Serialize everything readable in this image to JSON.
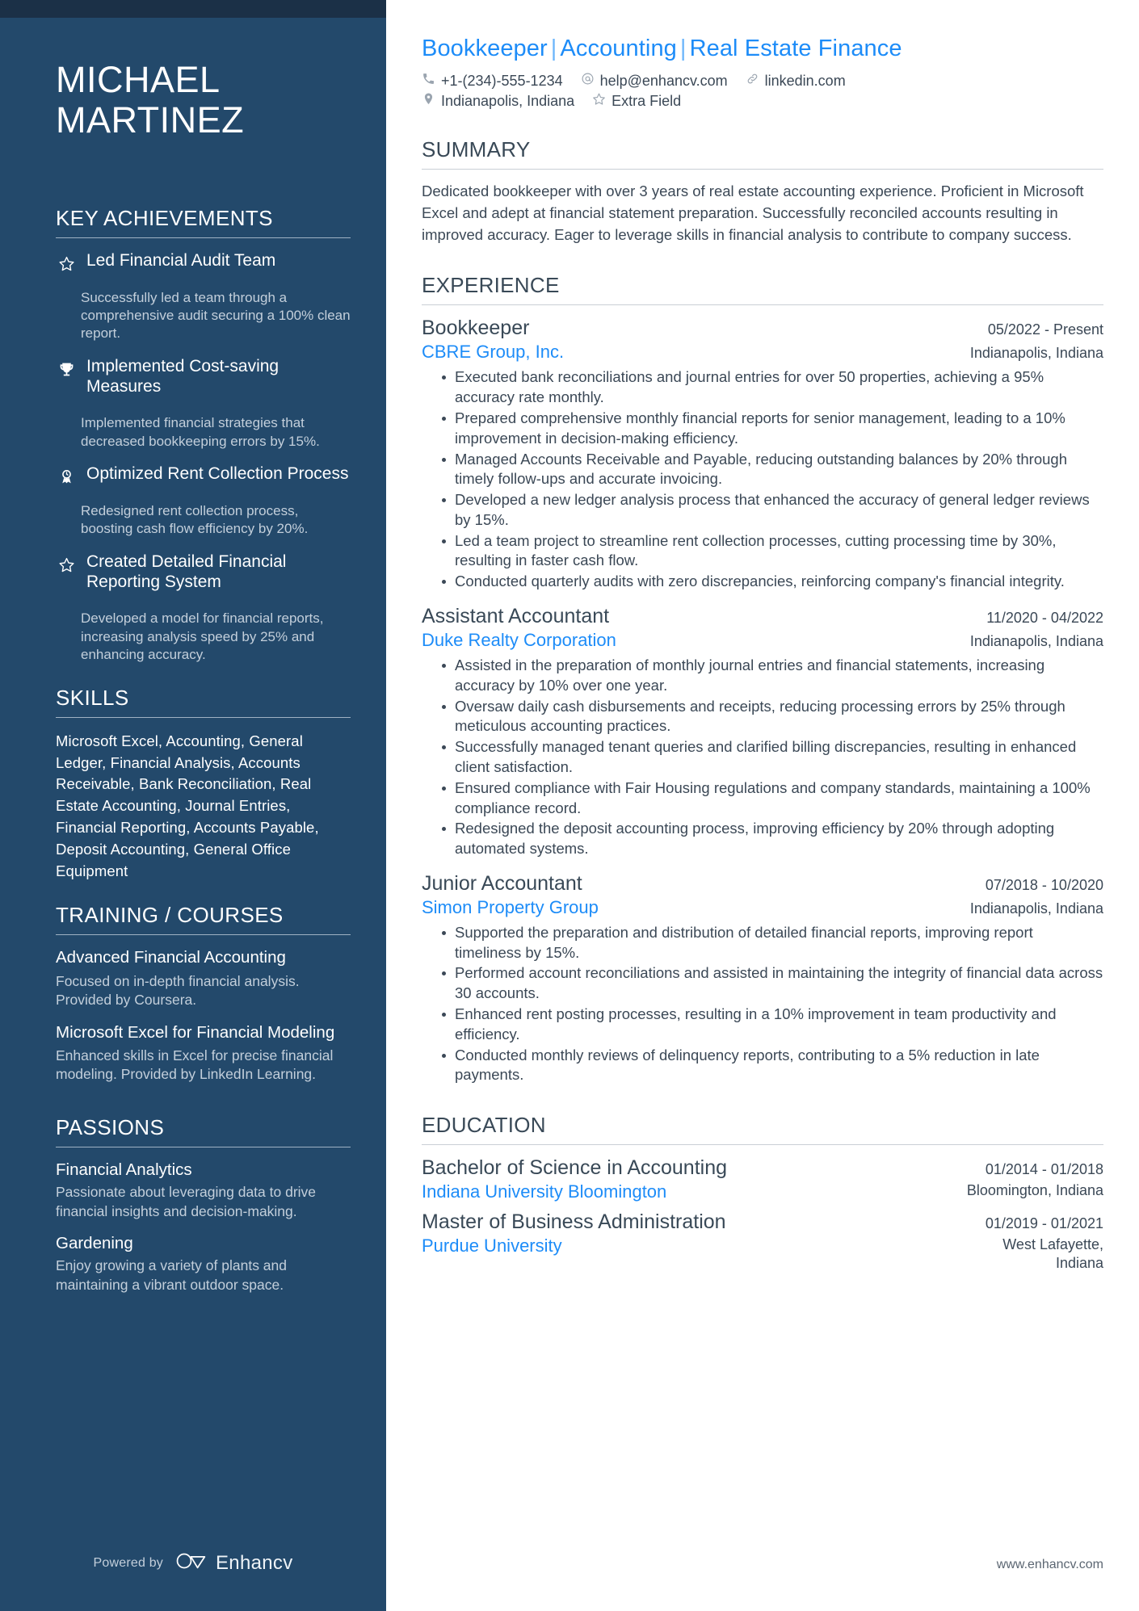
{
  "sidebar": {
    "name_line1": "MICHAEL",
    "name_line2": "MARTINEZ",
    "key_achievements": {
      "heading": "KEY ACHIEVEMENTS",
      "items": [
        {
          "icon": "star-icon",
          "title": "Led Financial Audit Team",
          "desc": "Successfully led a team through a comprehensive audit securing a 100% clean report."
        },
        {
          "icon": "trophy-icon",
          "title": "Implemented Cost-saving Measures",
          "desc": "Implemented financial strategies that decreased bookkeeping errors by 15%."
        },
        {
          "icon": "award-ribbon-icon",
          "title": "Optimized Rent Collection Process",
          "desc": "Redesigned rent collection process, boosting cash flow efficiency by 20%."
        },
        {
          "icon": "star-icon",
          "title": "Created Detailed Financial Reporting System",
          "desc": "Developed a model for financial reports, increasing analysis speed by 25% and enhancing accuracy."
        }
      ]
    },
    "skills": {
      "heading": "SKILLS",
      "text": "Microsoft Excel, Accounting, General Ledger, Financial Analysis, Accounts Receivable, Bank Reconciliation, Real Estate Accounting, Journal Entries, Financial Reporting, Accounts Payable, Deposit Accounting, General Office Equipment"
    },
    "training": {
      "heading": "TRAINING / COURSES",
      "items": [
        {
          "title": "Advanced Financial Accounting",
          "desc": "Focused on in-depth financial analysis. Provided by Coursera."
        },
        {
          "title": "Microsoft Excel for Financial Modeling",
          "desc": "Enhanced skills in Excel for precise financial modeling. Provided by LinkedIn Learning."
        }
      ]
    },
    "passions": {
      "heading": "PASSIONS",
      "items": [
        {
          "title": "Financial Analytics",
          "desc": "Passionate about leveraging data to drive financial insights and decision-making."
        },
        {
          "title": "Gardening",
          "desc": "Enjoy growing a variety of plants and maintaining a vibrant outdoor space."
        }
      ]
    },
    "footer": {
      "powered_by": "Powered by",
      "brand": "Enhancv"
    }
  },
  "main": {
    "headline": {
      "part1": "Bookkeeper",
      "part2": "Accounting",
      "part3": "Real Estate Finance",
      "separator": "|"
    },
    "contact": {
      "phone": "+1-(234)-555-1234",
      "email": "help@enhancv.com",
      "linkedin": "linkedin.com",
      "location": "Indianapolis, Indiana",
      "extra": "Extra Field"
    },
    "summary": {
      "heading": "SUMMARY",
      "text": "Dedicated bookkeeper with over 3 years of real estate accounting experience. Proficient in Microsoft Excel and adept at financial statement preparation. Successfully reconciled accounts resulting in improved accuracy. Eager to leverage skills in financial analysis to contribute to company success."
    },
    "experience": {
      "heading": "EXPERIENCE",
      "jobs": [
        {
          "title": "Bookkeeper",
          "dates": "05/2022 - Present",
          "company": "CBRE Group, Inc.",
          "location": "Indianapolis, Indiana",
          "bullets": [
            "Executed bank reconciliations and journal entries for over 50 properties, achieving a 95% accuracy rate monthly.",
            "Prepared comprehensive monthly financial reports for senior management, leading to a 10% improvement in decision-making efficiency.",
            "Managed Accounts Receivable and Payable, reducing outstanding balances by 20% through timely follow-ups and accurate invoicing.",
            "Developed a new ledger analysis process that enhanced the accuracy of general ledger reviews by 15%.",
            "Led a team project to streamline rent collection processes, cutting processing time by 30%, resulting in faster cash flow.",
            "Conducted quarterly audits with zero discrepancies, reinforcing company's financial integrity."
          ]
        },
        {
          "title": "Assistant Accountant",
          "dates": "11/2020 - 04/2022",
          "company": "Duke Realty Corporation",
          "location": "Indianapolis, Indiana",
          "bullets": [
            "Assisted in the preparation of monthly journal entries and financial statements, increasing accuracy by 10% over one year.",
            "Oversaw daily cash disbursements and receipts, reducing processing errors by 25% through meticulous accounting practices.",
            "Successfully managed tenant queries and clarified billing discrepancies, resulting in enhanced client satisfaction.",
            "Ensured compliance with Fair Housing regulations and company standards, maintaining a 100% compliance record.",
            "Redesigned the deposit accounting process, improving efficiency by 20% through adopting automated systems."
          ]
        },
        {
          "title": "Junior Accountant",
          "dates": "07/2018 - 10/2020",
          "company": "Simon Property Group",
          "location": "Indianapolis, Indiana",
          "bullets": [
            "Supported the preparation and distribution of detailed financial reports, improving report timeliness by 15%.",
            "Performed account reconciliations and assisted in maintaining the integrity of financial data across 30 accounts.",
            "Enhanced rent posting processes, resulting in a 10% improvement in team productivity and efficiency.",
            "Conducted monthly reviews of delinquency reports, contributing to a 5% reduction in late payments."
          ]
        }
      ]
    },
    "education": {
      "heading": "EDUCATION",
      "entries": [
        {
          "degree": "Bachelor of Science in Accounting",
          "dates": "01/2014 - 01/2018",
          "school": "Indiana University Bloomington",
          "location": "Bloomington, Indiana"
        },
        {
          "degree": "Master of Business Administration",
          "dates": "01/2019 - 01/2021",
          "school": "Purdue University",
          "location": "West Lafayette, Indiana"
        }
      ]
    },
    "footer_url": "www.enhancv.com"
  },
  "colors": {
    "sidebar_bg": "#23496b",
    "accent_blue": "#1d8cf8",
    "text_dark": "#3b4856"
  }
}
